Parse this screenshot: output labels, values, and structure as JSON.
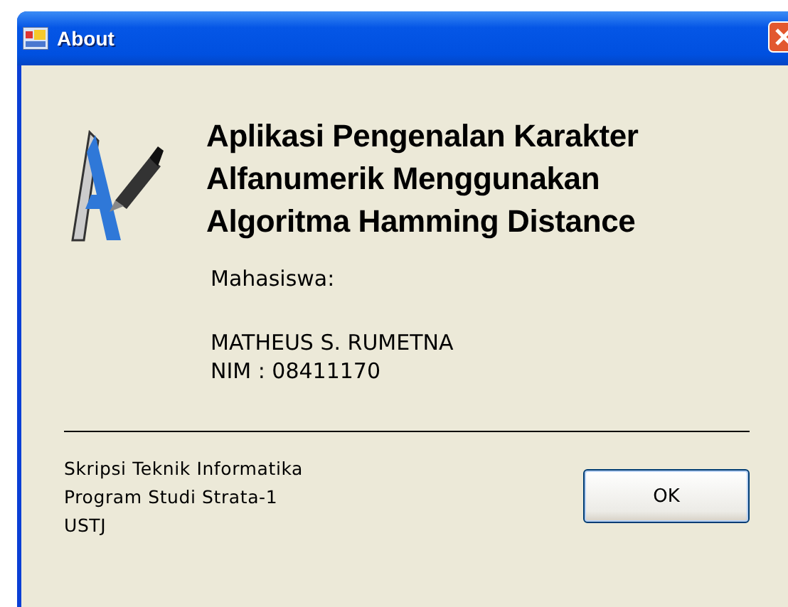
{
  "window": {
    "title": "About"
  },
  "app_title": [
    "Aplikasi Pengenalan Karakter",
    "Alfanumerik Menggunakan",
    "Algoritma Hamming Distance"
  ],
  "student_label": "Mahasiswa:",
  "student_name": "MATHEUS S. RUMETNA",
  "student_id": "NIM : 08411170",
  "footer_lines": [
    "Skripsi Teknik Informatika",
    "Program Studi Strata-1",
    "USTJ"
  ],
  "buttons": [
    "OK"
  ]
}
